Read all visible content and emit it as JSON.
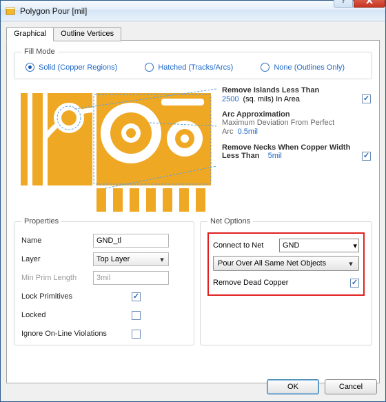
{
  "window": {
    "title": "Polygon Pour [mil]"
  },
  "tabs": {
    "graphical": "Graphical",
    "outline": "Outline Vertices"
  },
  "fillmode": {
    "legend": "Fill Mode",
    "solid": "Solid (Copper Regions)",
    "hatched": "Hatched (Tracks/Arcs)",
    "none": "None (Outlines Only)"
  },
  "opts": {
    "islands_title": "Remove Islands Less Than",
    "islands_val": "2500",
    "islands_unit": "(sq. mils)  In Area",
    "arc_title": "Arc Approximation",
    "arc_sub": "Maximum Deviation From Perfect Arc",
    "arc_val": "0.5mil",
    "necks_title": "Remove Necks When Copper Width Less Than",
    "necks_val": "5mil"
  },
  "props": {
    "legend": "Properties",
    "name_label": "Name",
    "name_value": "GND_tl",
    "layer_label": "Layer",
    "layer_value": "Top Layer",
    "minprim_label": "Min Prim Length",
    "minprim_value": "3mil",
    "lockprim_label": "Lock Primitives",
    "locked_label": "Locked",
    "ignore_label": "Ignore On-Line Violations"
  },
  "net": {
    "legend": "Net Options",
    "connect_label": "Connect to Net",
    "connect_value": "GND",
    "pour_value": "Pour Over All Same Net Objects",
    "dead_label": "Remove Dead Copper"
  },
  "buttons": {
    "ok": "OK",
    "cancel": "Cancel"
  }
}
